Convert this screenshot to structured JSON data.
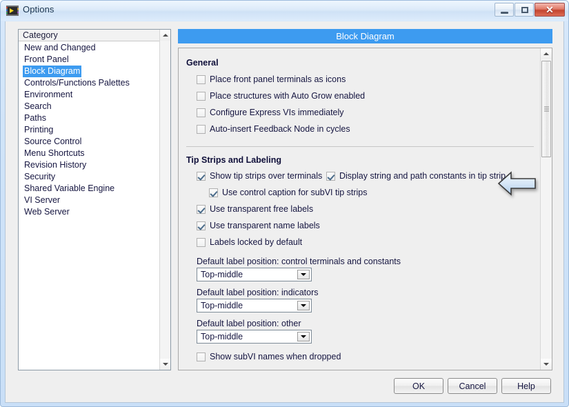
{
  "window": {
    "title": "Options",
    "icon": "labview-vi-icon",
    "controls": {
      "minimize": "minimize-button",
      "restore": "restore-button",
      "close_glyph": "✕"
    }
  },
  "category_list": {
    "header": "Category",
    "selected": "Block Diagram",
    "items": [
      "New and Changed",
      "Front Panel",
      "Block Diagram",
      "Controls/Functions Palettes",
      "Environment",
      "Search",
      "Paths",
      "Printing",
      "Source Control",
      "Menu Shortcuts",
      "Revision History",
      "Security",
      "Shared Variable Engine",
      "VI Server",
      "Web Server"
    ]
  },
  "panel": {
    "header": "Block Diagram",
    "sections": [
      {
        "title": "General",
        "checkboxes": [
          {
            "label": "Place front panel terminals as icons",
            "checked": false
          },
          {
            "label": "Place structures with Auto Grow enabled",
            "checked": false
          },
          {
            "label": "Configure Express VIs immediately",
            "checked": false
          },
          {
            "label": "Auto-insert Feedback Node in cycles",
            "checked": false
          }
        ]
      },
      {
        "title": "Tip Strips and Labeling",
        "checkboxes": [
          {
            "label": "Show tip strips over terminals",
            "checked": true
          },
          {
            "label": "Display string and path constants in tip strip",
            "checked": true
          },
          {
            "label": "Use control caption for subVI tip strips",
            "checked": true
          },
          {
            "label": "Use transparent free labels",
            "checked": true
          },
          {
            "label": "Use transparent name labels",
            "checked": true
          },
          {
            "label": "Labels locked by default",
            "checked": false
          },
          {
            "label": "Show subVI names when dropped",
            "checked": false
          }
        ],
        "dropdowns": [
          {
            "label": "Default label position: control terminals and constants",
            "value": "Top-middle"
          },
          {
            "label": "Default label position: indicators",
            "value": "Top-middle"
          },
          {
            "label": "Default label position: other",
            "value": "Top-middle"
          }
        ]
      }
    ]
  },
  "annotation": {
    "arrow": "left-pointing-arrow",
    "color": "#cfe2f5"
  },
  "footer": {
    "ok": "OK",
    "cancel": "Cancel",
    "help": "Help"
  },
  "colors": {
    "accent": "#3d9bf0",
    "dialog_bg": "#efefef",
    "text": "#151540"
  }
}
